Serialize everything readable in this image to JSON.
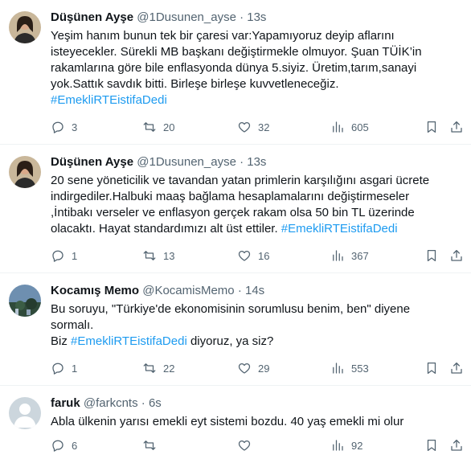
{
  "tweets": [
    {
      "name": "Düşünen Ayşe",
      "handle": "@1Dusunen_ayse",
      "sep": "·",
      "time": "13s",
      "lines": [
        "Yeşim hanım bunun tek bir çaresi var:Yapamıyoruz deyip aflarını",
        "isteyecekler. Sürekli MB başkanı değiştirmekle olmuyor. Şuan TÜİK’in",
        "rakamlarına göre bile enflasyonda dünya 5.siyiz. Üretim,tarım,sanayi",
        "yok.Sattık savdık bitti. Birleşe birleşe kuvvetleneceğiz."
      ],
      "hashtag": "#EmekliRTEistifaDedi",
      "replies": "3",
      "retweets": "20",
      "likes": "32",
      "views": "605",
      "avatar": "woman"
    },
    {
      "name": "Düşünen Ayşe",
      "handle": "@1Dusunen_ayse",
      "sep": "·",
      "time": "13s",
      "lines": [
        "20 sene yöneticilik ve tavandan yatan primlerin karşılığını asgari ücrete",
        "indirgediler.Halbuki maaş bağlama hesaplamalarını değiştirmeseler",
        ",İntibakı verseler ve enflasyon gerçek rakam olsa 50 bin TL üzerinde"
      ],
      "last_line": "olacaktı. Hayat standardımızı alt üst ettiler. ",
      "hashtag": "#EmekliRTEistifaDedi",
      "replies": "1",
      "retweets": "13",
      "likes": "16",
      "views": "367",
      "avatar": "woman"
    },
    {
      "name": "Kocamış Memo",
      "handle": "@KocamisMemo",
      "sep": "·",
      "time": "14s",
      "lines": [
        "Bu soruyu, \"Türkiye'de ekonomisinin sorumlusu benim, ben\" diyene",
        "sormalı."
      ],
      "line_prefix": "Biz ",
      "hashtag": "#EmekliRTEistifaDedi",
      "line_suffix": " diyoruz, ya siz?",
      "replies": "1",
      "retweets": "22",
      "likes": "29",
      "views": "553",
      "avatar": "landscape"
    },
    {
      "name": "faruk",
      "handle": "@farkcnts",
      "sep": "·",
      "time": "6s",
      "lines": [
        "Abla ülkenin yarısı emekli eyt sistemi bozdu. 40 yaş emekli mi olur"
      ],
      "replies": "6",
      "retweets": "",
      "likes": "",
      "views": "92",
      "avatar": "default"
    }
  ],
  "colors": {
    "link": "#1d9bf0",
    "muted": "#536471",
    "text": "#0f1419",
    "divider": "#eff3f4"
  },
  "icons": [
    "reply-icon",
    "retweet-icon",
    "like-icon",
    "views-icon",
    "bookmark-icon",
    "share-icon"
  ]
}
